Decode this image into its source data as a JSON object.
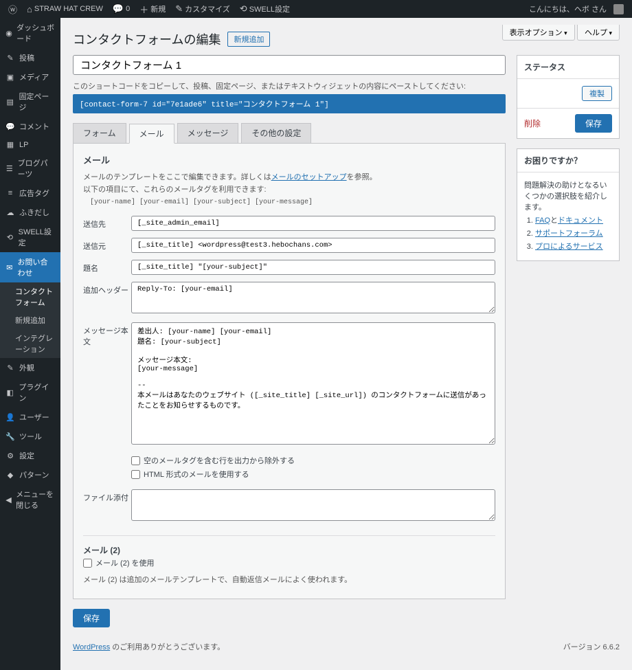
{
  "adminbar": {
    "site": "STRAW HAT CREW",
    "comments": "0",
    "new": "新規",
    "customize": "カスタマイズ",
    "swell": "SWELL設定",
    "greeting_pre": "こんにちは、",
    "greeting_user": "ヘボ さん"
  },
  "menu": {
    "dashboard": "ダッシュボード",
    "posts": "投稿",
    "media": "メディア",
    "pages": "固定ページ",
    "comments": "コメント",
    "lp": "LP",
    "blogparts": "ブログパーツ",
    "adtag": "広告タグ",
    "fukidashi": "ふきだし",
    "swell": "SWELL設定",
    "contact": "お問い合わせ",
    "contact_sub1": "コンタクトフォーム",
    "contact_sub2": "新規追加",
    "contact_sub3": "インテグレーション",
    "appearance": "外観",
    "plugins": "プラグイン",
    "users": "ユーザー",
    "tools": "ツール",
    "settings": "設定",
    "patterns": "パターン",
    "collapse": "メニューを閉じる"
  },
  "screen": {
    "options": "表示オプション",
    "help": "ヘルプ"
  },
  "page": {
    "title": "コンタクトフォームの編集",
    "add_new": "新規追加"
  },
  "form": {
    "title": "コンタクトフォーム 1"
  },
  "shortcode_hint": "このショートコードをコピーして、投稿、固定ページ、またはテキストウィジェットの内容にペーストしてください:",
  "shortcode": "[contact-form-7 id=\"7e1ade6\" title=\"コンタクトフォーム 1\"]",
  "tabs": {
    "form": "フォーム",
    "mail": "メール",
    "messages": "メッセージ",
    "other": "その他の設定"
  },
  "mailpanel": {
    "heading": "メール",
    "desc1": "メールのテンプレートをここで編集できます。詳しくは",
    "desc_link": "メールのセットアップ",
    "desc2": "を参照。",
    "desc3": "以下の項目にて、これらのメールタグを利用できます:",
    "tags": "[your-name] [your-email] [your-subject] [your-message]",
    "to_label": "送信先",
    "to": "[_site_admin_email]",
    "from_label": "送信元",
    "from": "[_site_title] <wordpress@test3.hebochans.com>",
    "subject_label": "題名",
    "subject": "[_site_title] \"[your-subject]\"",
    "headers_label": "追加ヘッダー",
    "headers": "Reply-To: [your-email]",
    "body_label": "メッセージ本文",
    "body": "差出人: [your-name] [your-email]\n題名: [your-subject]\n\nメッセージ本文:\n[your-message]\n\n-- \n本メールはあなたのウェブサイト ([_site_title] [_site_url]) のコンタクトフォームに送信があったことをお知らせするものです。",
    "exclude": "空のメールタグを含む行を出力から除外する",
    "usehtml": "HTML 形式のメールを使用する",
    "attach_label": "ファイル添付",
    "mail2_h": "メール (2)",
    "mail2_chk": "メール (2) を使用",
    "mail2_note": "メール (2) は追加のメールテンプレートで、自動返信メールによく使われます。"
  },
  "save": "保存",
  "sidebar": {
    "status_h": "ステータス",
    "duplicate": "複製",
    "delete": "削除",
    "save": "保存",
    "help_h": "お困りですか？",
    "help_p": "問題解決の助けとなるいくつかの選択肢を紹介します。",
    "help1a": "FAQ",
    "help1b": "と",
    "help1c": "ドキュメント",
    "help2": "サポートフォーラム",
    "help3": "プロによるサービス"
  },
  "footer": {
    "thanks_pre": "WordPress",
    "thanks_post": " のご利用ありがとうございます。",
    "version": "バージョン 6.6.2"
  }
}
